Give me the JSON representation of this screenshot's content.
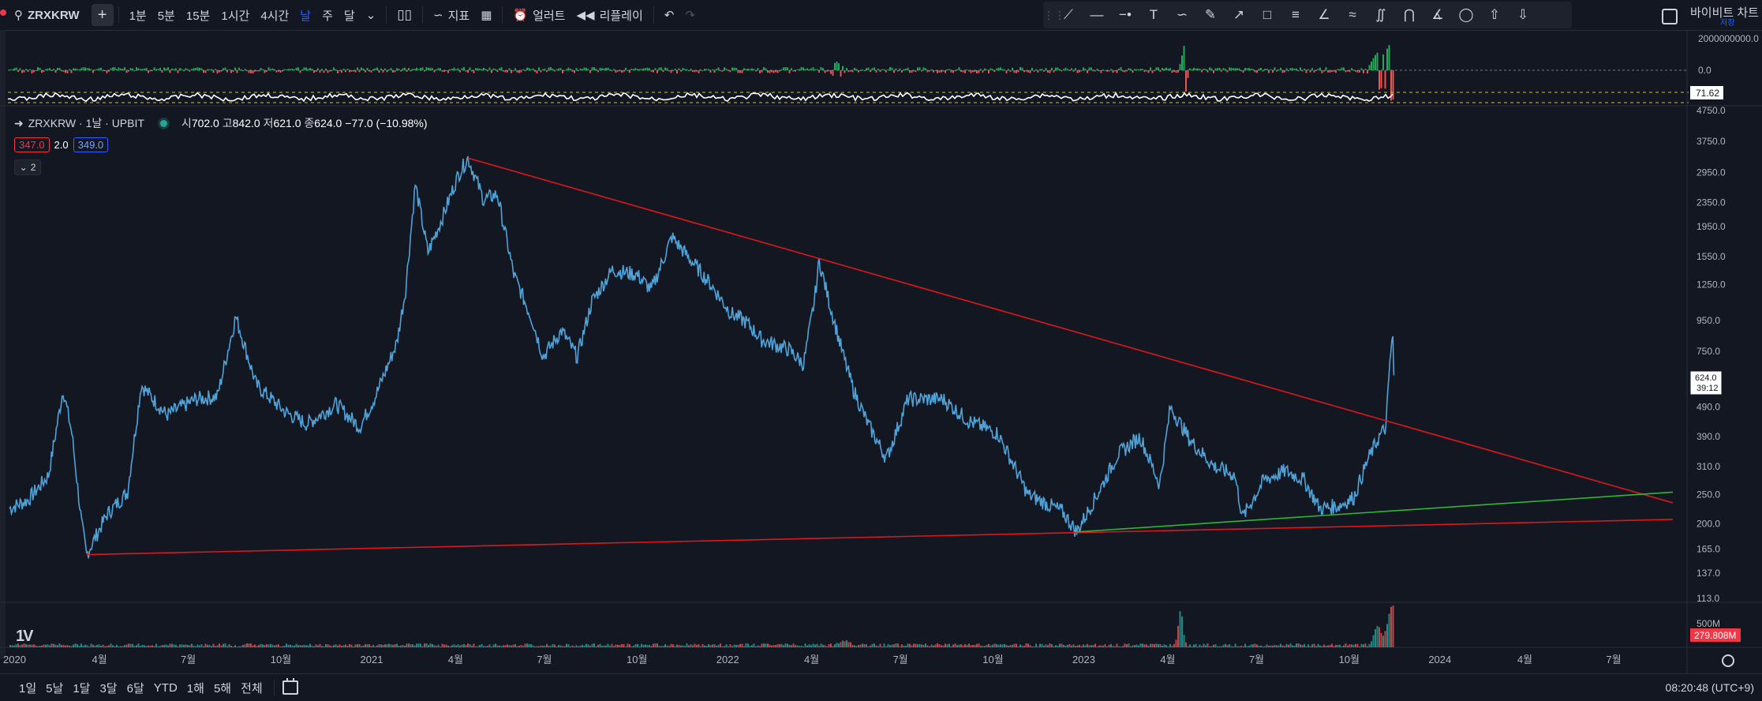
{
  "toolbar": {
    "symbol": "ZRXKRW",
    "add_label": "+",
    "intervals": [
      "1분",
      "5분",
      "15분",
      "1시간",
      "4시간",
      "날",
      "주",
      "달"
    ],
    "active_interval": "날",
    "chart_type_icon": "candles-icon",
    "indicators_label": "지표",
    "alerts_label": "얼러트",
    "replay_label": "리플레이",
    "right_label": "바이비트 차트",
    "right_sublabel": "저장"
  },
  "drawing_tools": [
    "trend-line-icon",
    "horizontal-line-icon",
    "horizontal-ray-icon",
    "text-icon",
    "path-icon",
    "brush-icon",
    "ray-icon",
    "rectangle-icon",
    "fib-icon",
    "angle-icon",
    "zigzag-icon",
    "pattern-icon",
    "pitchfork-icon",
    "polyline-icon",
    "circle-icon",
    "arrow-up-icon",
    "arrow-down-icon"
  ],
  "legend": {
    "title": "ZRXKRW · 1날 · UPBIT",
    "open_label": "시",
    "open": "702.0",
    "high_label": "고",
    "high": "842.0",
    "low_label": "저",
    "low": "621.0",
    "close_label": "종",
    "close": "624.0",
    "change": "−77.0 (−10.98%)",
    "ind_lower": "347.0",
    "ind_mult": "2.0",
    "ind_upper": "349.0",
    "collapse_count": "2"
  },
  "colors": {
    "background": "#131722",
    "price_line": "#4fa3d9",
    "trendline": "#e0161b",
    "support": "#2db634",
    "up": "#26a69a",
    "down": "#ef5350"
  },
  "pane_labels": {
    "osc_top": "2000000000.0",
    "osc_zero": "0.0",
    "rsi_value": "71.62",
    "volume_axis": "500M",
    "volume_value": "279.808M",
    "last_price": "624.0",
    "countdown": "39:12"
  },
  "chart_data": {
    "type": "line",
    "scale": "log",
    "y_ticks": [
      4750,
      3750,
      2950,
      2350,
      1950,
      1550,
      1250,
      950,
      750,
      490,
      390,
      310,
      250,
      200,
      165,
      137,
      113
    ],
    "ylim": [
      113,
      4750
    ],
    "xlim": [
      "2020-01-01",
      "2024-09-01"
    ],
    "x_tick_labels": [
      "2020",
      "4월",
      "7월",
      "10월",
      "2021",
      "4월",
      "7월",
      "10월",
      "2022",
      "4월",
      "7월",
      "10월",
      "2023",
      "4월",
      "7월",
      "10월",
      "2024",
      "4월",
      "7월"
    ],
    "x_tick_dates": [
      "2020-01-01",
      "2020-04-01",
      "2020-07-01",
      "2020-10-01",
      "2021-01-01",
      "2021-04-01",
      "2021-07-01",
      "2021-10-01",
      "2022-01-01",
      "2022-04-01",
      "2022-07-01",
      "2022-10-01",
      "2023-01-01",
      "2023-04-01",
      "2023-07-01",
      "2023-10-01",
      "2024-01-01",
      "2024-04-01",
      "2024-07-01"
    ],
    "series": [
      {
        "points": [
          [
            "2020-01-01",
            225
          ],
          [
            "2020-01-20",
            240
          ],
          [
            "2020-02-10",
            290
          ],
          [
            "2020-02-25",
            560
          ],
          [
            "2020-03-05",
            400
          ],
          [
            "2020-03-15",
            200
          ],
          [
            "2020-03-20",
            158
          ],
          [
            "2020-04-10",
            215
          ],
          [
            "2020-05-01",
            255
          ],
          [
            "2020-05-15",
            580
          ],
          [
            "2020-06-10",
            460
          ],
          [
            "2020-07-10",
            520
          ],
          [
            "2020-08-01",
            530
          ],
          [
            "2020-08-20",
            980
          ],
          [
            "2020-09-10",
            580
          ],
          [
            "2020-10-10",
            470
          ],
          [
            "2020-11-01",
            430
          ],
          [
            "2020-12-01",
            500
          ],
          [
            "2020-12-25",
            420
          ],
          [
            "2021-01-10",
            530
          ],
          [
            "2021-02-01",
            800
          ],
          [
            "2021-02-10",
            1200
          ],
          [
            "2021-02-20",
            2700
          ],
          [
            "2021-03-05",
            1600
          ],
          [
            "2021-03-20",
            2100
          ],
          [
            "2021-04-05",
            2900
          ],
          [
            "2021-04-15",
            3300
          ],
          [
            "2021-05-01",
            2400
          ],
          [
            "2021-05-15",
            2500
          ],
          [
            "2021-06-01",
            1350
          ],
          [
            "2021-06-20",
            950
          ],
          [
            "2021-07-01",
            720
          ],
          [
            "2021-07-20",
            880
          ],
          [
            "2021-08-05",
            720
          ],
          [
            "2021-08-20",
            1100
          ],
          [
            "2021-09-10",
            1400
          ],
          [
            "2021-10-05",
            1350
          ],
          [
            "2021-10-20",
            1200
          ],
          [
            "2021-11-10",
            1800
          ],
          [
            "2021-11-30",
            1500
          ],
          [
            "2021-12-20",
            1250
          ],
          [
            "2022-01-10",
            1000
          ],
          [
            "2022-01-25",
            940
          ],
          [
            "2022-02-10",
            820
          ],
          [
            "2022-03-10",
            760
          ],
          [
            "2022-03-25",
            680
          ],
          [
            "2022-04-05",
            1100
          ],
          [
            "2022-04-10",
            1500
          ],
          [
            "2022-04-20",
            1100
          ],
          [
            "2022-05-05",
            720
          ],
          [
            "2022-05-15",
            560
          ],
          [
            "2022-05-30",
            430
          ],
          [
            "2022-06-18",
            330
          ],
          [
            "2022-07-10",
            520
          ],
          [
            "2022-08-15",
            520
          ],
          [
            "2022-09-10",
            440
          ],
          [
            "2022-10-10",
            400
          ],
          [
            "2022-10-25",
            320
          ],
          [
            "2022-11-10",
            250
          ],
          [
            "2022-12-15",
            220
          ],
          [
            "2022-12-30",
            188
          ],
          [
            "2023-01-20",
            250
          ],
          [
            "2023-02-10",
            340
          ],
          [
            "2023-03-05",
            390
          ],
          [
            "2023-03-25",
            270
          ],
          [
            "2023-04-05",
            490
          ],
          [
            "2023-04-25",
            380
          ],
          [
            "2023-05-20",
            310
          ],
          [
            "2023-06-10",
            290
          ],
          [
            "2023-06-18",
            210
          ],
          [
            "2023-07-10",
            280
          ],
          [
            "2023-08-01",
            300
          ],
          [
            "2023-08-20",
            280
          ],
          [
            "2023-09-05",
            225
          ],
          [
            "2023-09-25",
            230
          ],
          [
            "2023-10-10",
            245
          ],
          [
            "2023-10-25",
            330
          ],
          [
            "2023-11-05",
            390
          ],
          [
            "2023-11-12",
            420
          ],
          [
            "2023-11-16",
            700
          ],
          [
            "2023-11-19",
            842
          ],
          [
            "2023-11-20",
            624
          ]
        ]
      }
    ],
    "trendlines": [
      {
        "color": "red",
        "from": [
          "2021-04-15",
          3300
        ],
        "to": [
          "2024-09-01",
          235
        ]
      },
      {
        "color": "red",
        "from": [
          "2020-03-20",
          158
        ],
        "to": [
          "2024-09-01",
          207
        ]
      },
      {
        "color": "green",
        "from": [
          "2022-12-30",
          188
        ],
        "to": [
          "2024-09-01",
          255
        ]
      }
    ]
  },
  "bottombar": {
    "ranges": [
      "1일",
      "5날",
      "1달",
      "3달",
      "6달",
      "YTD",
      "1해",
      "5해",
      "전체"
    ],
    "clock": "08:20:48 (UTC+9)"
  }
}
